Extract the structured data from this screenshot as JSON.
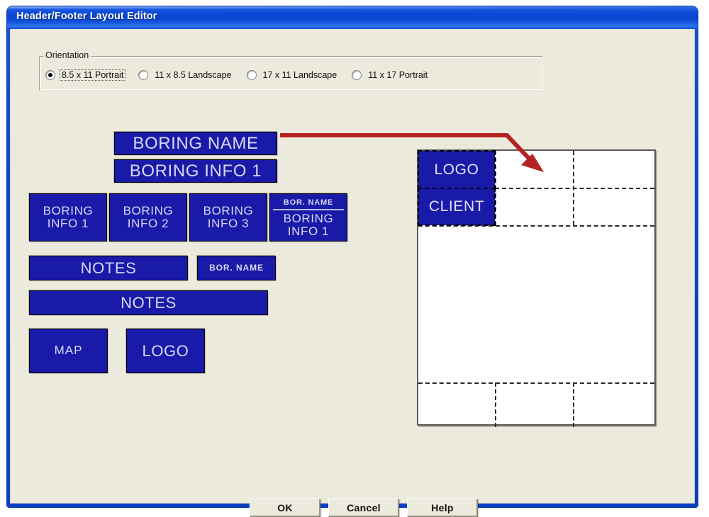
{
  "window": {
    "title": "Header/Footer Layout Editor"
  },
  "orientation": {
    "legend": "Orientation",
    "options": [
      {
        "label": "8.5 x 11 Portrait",
        "selected": true
      },
      {
        "label": "11 x 8.5 Landscape",
        "selected": false
      },
      {
        "label": "17 x 11 Landscape",
        "selected": false
      },
      {
        "label": "11 x 17 Portrait",
        "selected": false
      }
    ]
  },
  "palette": {
    "boring_name": "BORING NAME",
    "boring_info_1": "BORING INFO 1",
    "info_box_1_line1": "BORING",
    "info_box_1_line2": "INFO 1",
    "info_box_2_line1": "BORING",
    "info_box_2_line2": "INFO 2",
    "info_box_3_line1": "BORING",
    "info_box_3_line2": "INFO 3",
    "combo_header": "BOR. NAME",
    "combo_line1": "BORING",
    "combo_line2": "INFO 1",
    "notes_1": "NOTES",
    "bor_name_small": "BOR. NAME",
    "notes_2": "NOTES",
    "map": "MAP",
    "logo": "LOGO"
  },
  "preview": {
    "logo_block": "LOGO",
    "client_block": "CLIENT"
  },
  "buttons": {
    "ok": "OK",
    "cancel": "Cancel",
    "help": "Help"
  },
  "colors": {
    "title_bar_blue": "#0a45d2",
    "block_navy": "#1a1aa8",
    "dialog_background": "#ece9dd",
    "annotation_red": "#b52222",
    "page_white": "#ffffff"
  }
}
